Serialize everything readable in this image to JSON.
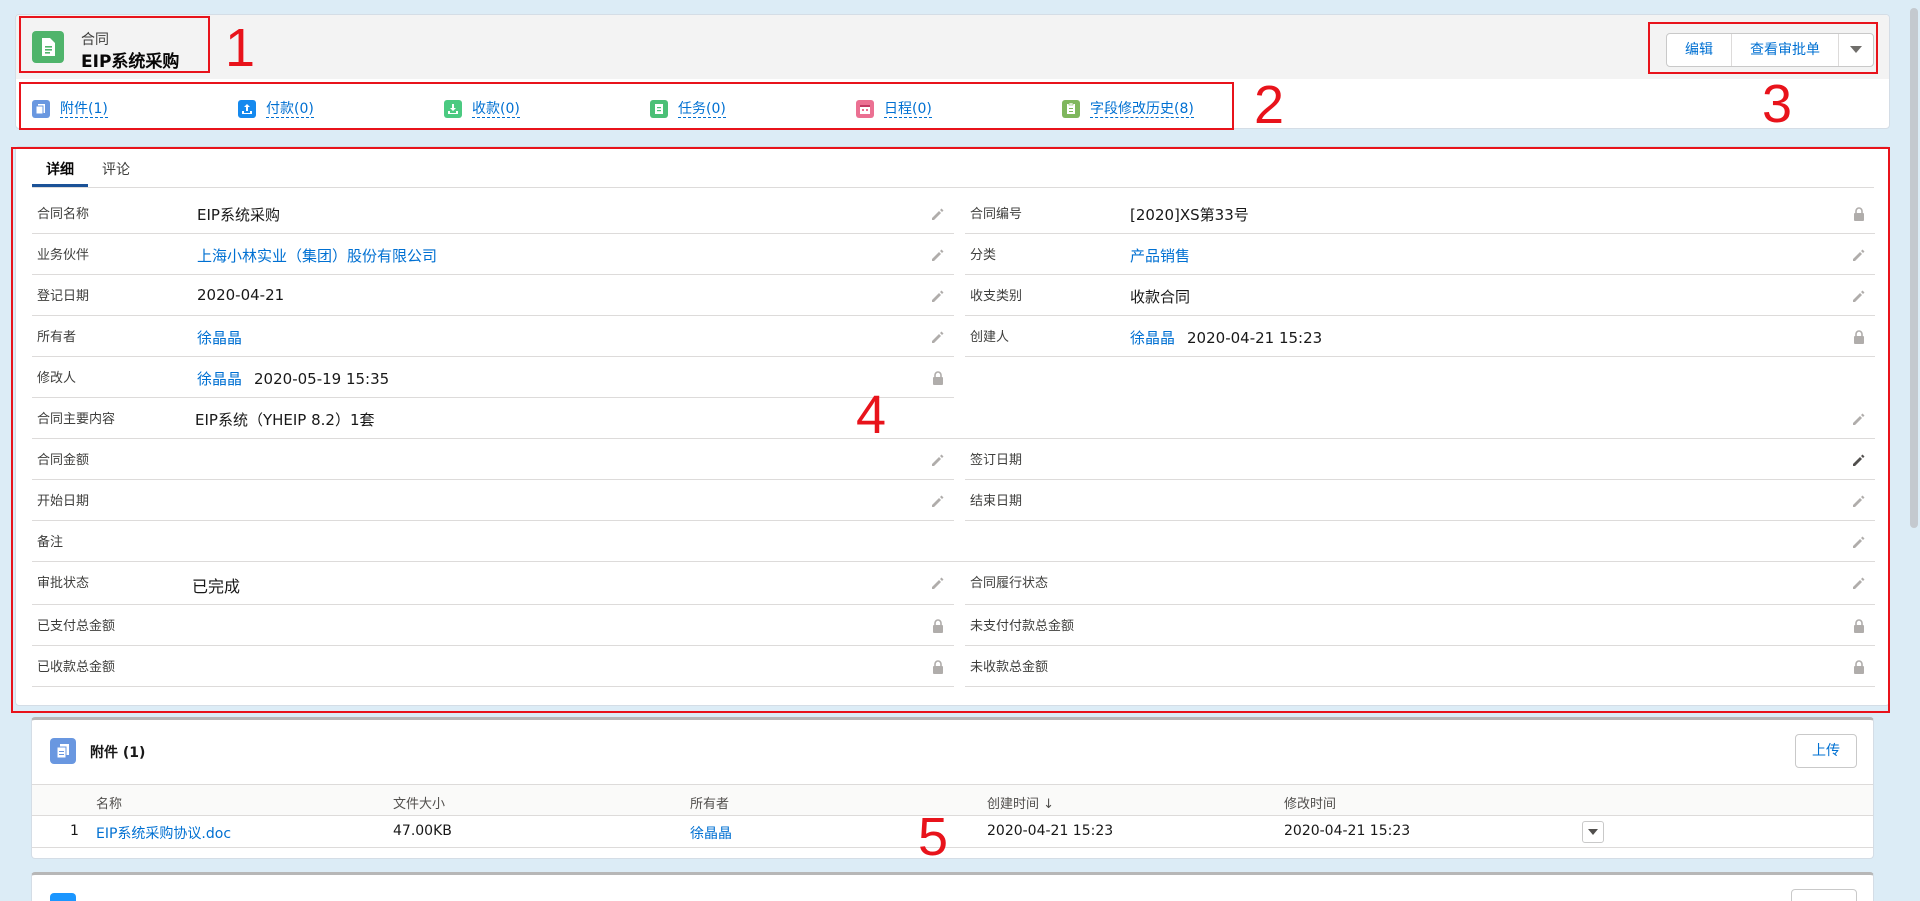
{
  "record": {
    "object_type": "合同",
    "title": "EIP系统采购"
  },
  "actions": {
    "edit": "编辑",
    "view_approval": "查看审批单"
  },
  "related_links": [
    {
      "label": "附件(1)",
      "icon": "attachment-icon",
      "color": "#6997e0"
    },
    {
      "label": "付款(0)",
      "icon": "upload-icon",
      "color": "#1589ee"
    },
    {
      "label": "收款(0)",
      "icon": "download-icon",
      "color": "#4bca81"
    },
    {
      "label": "任务(0)",
      "icon": "task-icon",
      "color": "#4bc076"
    },
    {
      "label": "日程(0)",
      "icon": "calendar-icon",
      "color": "#eb7092"
    },
    {
      "label": "字段修改历史(8)",
      "icon": "history-icon",
      "color": "#7fb75d"
    }
  ],
  "tabs": {
    "detail": "详细",
    "comments": "评论"
  },
  "fields": {
    "contract_name": {
      "label": "合同名称",
      "value": "EIP系统采购"
    },
    "contract_no": {
      "label": "合同编号",
      "value": "[2020]XS第33号"
    },
    "partner": {
      "label": "业务伙伴",
      "value": "上海小林实业（集团）股份有限公司"
    },
    "category": {
      "label": "分类",
      "value": "产品销售"
    },
    "register_date": {
      "label": "登记日期",
      "value": "2020-04-21"
    },
    "income_type": {
      "label": "收支类别",
      "value": "收款合同"
    },
    "owner": {
      "label": "所有者",
      "value": "徐晶晶"
    },
    "creator": {
      "label": "创建人",
      "user": "徐晶晶",
      "time": "2020-04-21 15:23"
    },
    "modifier": {
      "label": "修改人",
      "user": "徐晶晶",
      "time": "2020-05-19 15:35"
    },
    "main_content": {
      "label": "合同主要内容",
      "value": "EIP系统（YHEIP 8.2）1套"
    },
    "amount": {
      "label": "合同金额",
      "value": ""
    },
    "sign_date": {
      "label": "签订日期",
      "value": ""
    },
    "start_date": {
      "label": "开始日期",
      "value": ""
    },
    "end_date": {
      "label": "结束日期",
      "value": ""
    },
    "remark": {
      "label": "备注",
      "value": ""
    },
    "approval_status": {
      "label": "审批状态",
      "value": "已完成"
    },
    "perform_status": {
      "label": "合同履行状态",
      "value": ""
    },
    "paid_total": {
      "label": "已支付总金额",
      "value": ""
    },
    "unpaid_total": {
      "label": "未支付付款总金额",
      "value": ""
    },
    "received_total": {
      "label": "已收款总金额",
      "value": ""
    },
    "unreceived_total": {
      "label": "未收款总金额",
      "value": ""
    }
  },
  "attachments": {
    "title": "附件 (1)",
    "upload": "上传",
    "columns": {
      "name": "名称",
      "size": "文件大小",
      "owner": "所有者",
      "created": "创建时间 ↓",
      "modified": "修改时间"
    },
    "rows": [
      {
        "index": "1",
        "name": "EIP系统采购协议.doc",
        "size": "47.00KB",
        "owner": "徐晶晶",
        "created": "2020-04-21 15:23",
        "modified": "2020-04-21 15:23"
      }
    ]
  },
  "annotations": [
    "1",
    "2",
    "3",
    "4",
    "5"
  ],
  "colors": {
    "link": "#0070d2",
    "annotation": "#e8131b",
    "object_icon": "#4fb46b"
  }
}
